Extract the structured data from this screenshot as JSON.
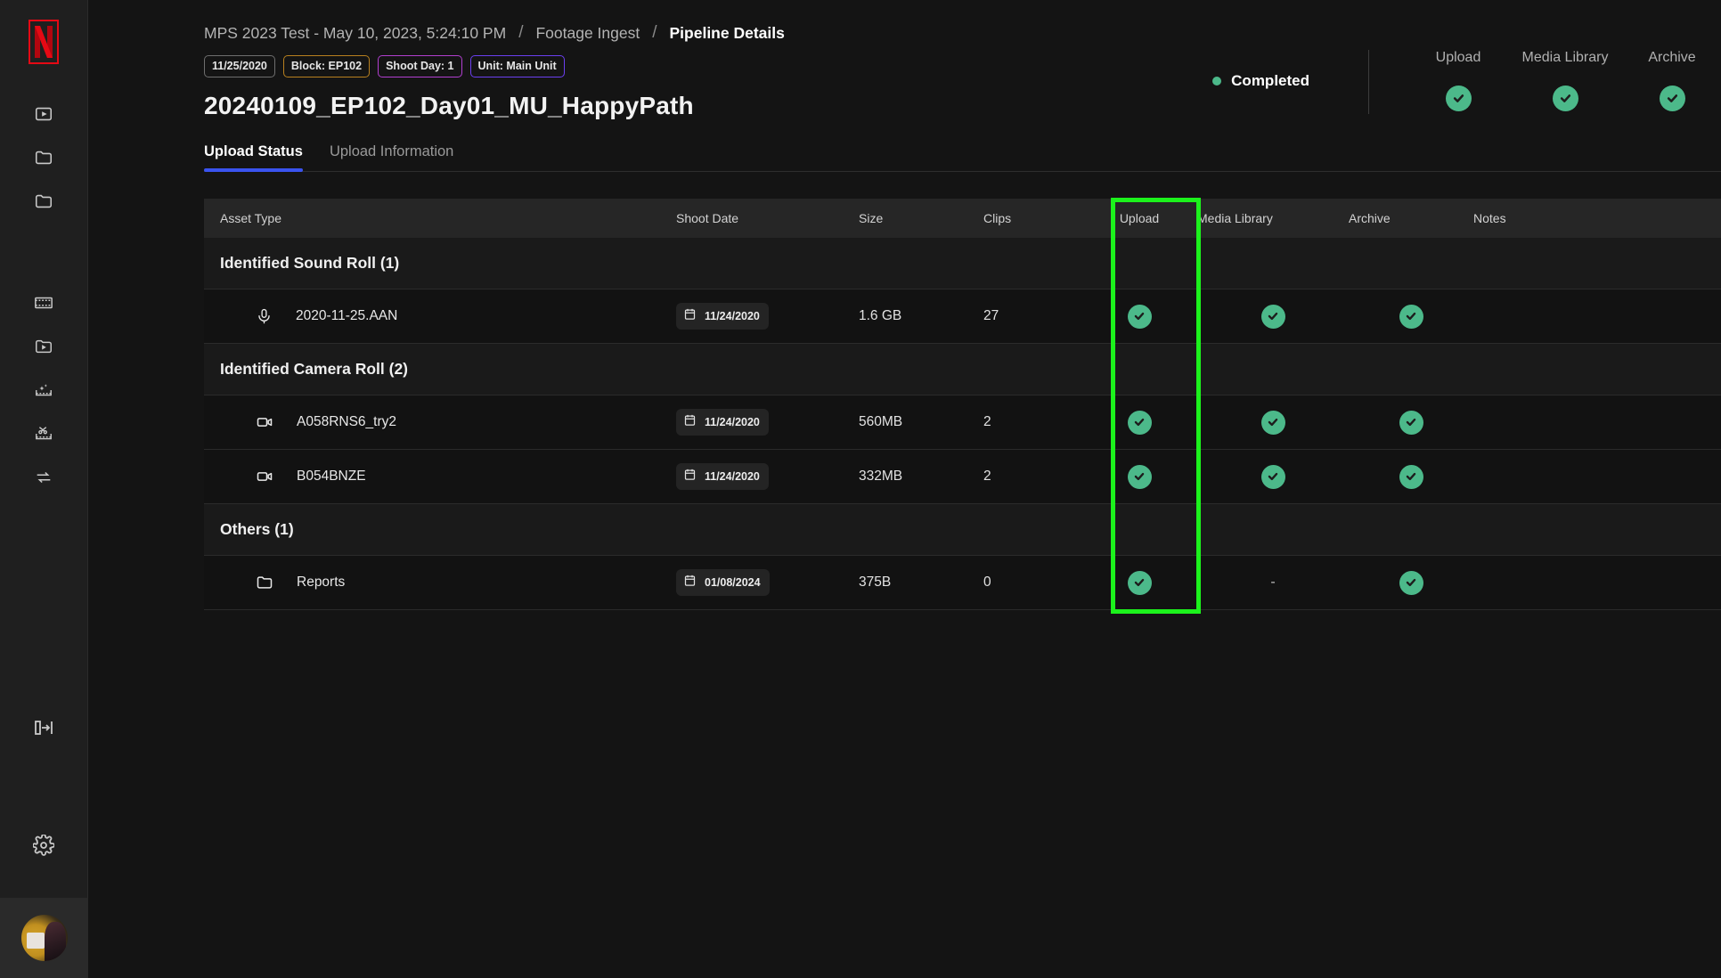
{
  "sidebar": {
    "logo": "netflix-logo",
    "items": [
      {
        "icon": "video-box-icon",
        "name": "nav-video-box"
      },
      {
        "icon": "folder-icon",
        "name": "nav-folder-1"
      },
      {
        "icon": "folder-icon",
        "name": "nav-folder-2"
      },
      {
        "icon": "film-strip-icon",
        "name": "nav-film-strip"
      },
      {
        "icon": "folder-play-icon",
        "name": "nav-folder-play"
      },
      {
        "icon": "film-sparkle-icon",
        "name": "nav-film-sparkle"
      },
      {
        "icon": "film-scissors-icon",
        "name": "nav-film-scissors"
      },
      {
        "icon": "export-arrow-icon",
        "name": "nav-export"
      }
    ],
    "collapse_icon": "collapse-panel-icon",
    "settings_icon": "gear-icon",
    "avatar": "user-avatar"
  },
  "breadcrumb": {
    "items": [
      {
        "label": "MPS 2023 Test - May 10, 2023, 5:24:10 PM",
        "current": false
      },
      {
        "label": "Footage Ingest",
        "current": false
      },
      {
        "label": "Pipeline Details",
        "current": true
      }
    ],
    "separator": "/"
  },
  "badges": [
    {
      "label": "11/25/2020",
      "style": "b-date"
    },
    {
      "label": "Block: EP102",
      "style": "b-block"
    },
    {
      "label": "Shoot Day: 1",
      "style": "b-shoot"
    },
    {
      "label": "Unit: Main Unit",
      "style": "b-unit"
    }
  ],
  "page_title": "20240109_EP102_Day01_MU_HappyPath",
  "tabs": [
    {
      "label": "Upload Status",
      "active": true
    },
    {
      "label": "Upload Information",
      "active": false
    }
  ],
  "status": {
    "label": "Completed",
    "dot_color": "#4cb98a",
    "summary": [
      {
        "label": "Upload",
        "state": "check"
      },
      {
        "label": "Media Library",
        "state": "check"
      },
      {
        "label": "Archive",
        "state": "check"
      }
    ]
  },
  "table": {
    "columns": [
      "Asset Type",
      "Shoot Date",
      "Size",
      "Clips",
      "Upload",
      "Media Library",
      "Archive",
      "Notes"
    ],
    "highlight_column": "Upload",
    "highlight_color": "#1cf21c",
    "groups": [
      {
        "title": "Identified Sound Roll (1)",
        "rows": [
          {
            "icon": "microphone-icon",
            "name": "2020-11-25.AAN",
            "shoot_date": "11/24/2020",
            "size": "1.6 GB",
            "clips": "27",
            "upload": "check",
            "media_library": "check",
            "archive": "check",
            "notes": ""
          }
        ]
      },
      {
        "title": "Identified Camera Roll (2)",
        "rows": [
          {
            "icon": "video-camera-icon",
            "name": "A058RNS6_try2",
            "shoot_date": "11/24/2020",
            "size": "560MB",
            "clips": "2",
            "upload": "check",
            "media_library": "check",
            "archive": "check",
            "notes": ""
          },
          {
            "icon": "video-camera-icon",
            "name": "B054BNZE",
            "shoot_date": "11/24/2020",
            "size": "332MB",
            "clips": "2",
            "upload": "check",
            "media_library": "check",
            "archive": "check",
            "notes": ""
          }
        ]
      },
      {
        "title": "Others (1)",
        "rows": [
          {
            "icon": "folder-icon",
            "name": "Reports",
            "shoot_date": "01/08/2024",
            "size": "375B",
            "clips": "0",
            "upload": "check",
            "media_library": "-",
            "archive": "check",
            "notes": ""
          }
        ]
      }
    ]
  }
}
